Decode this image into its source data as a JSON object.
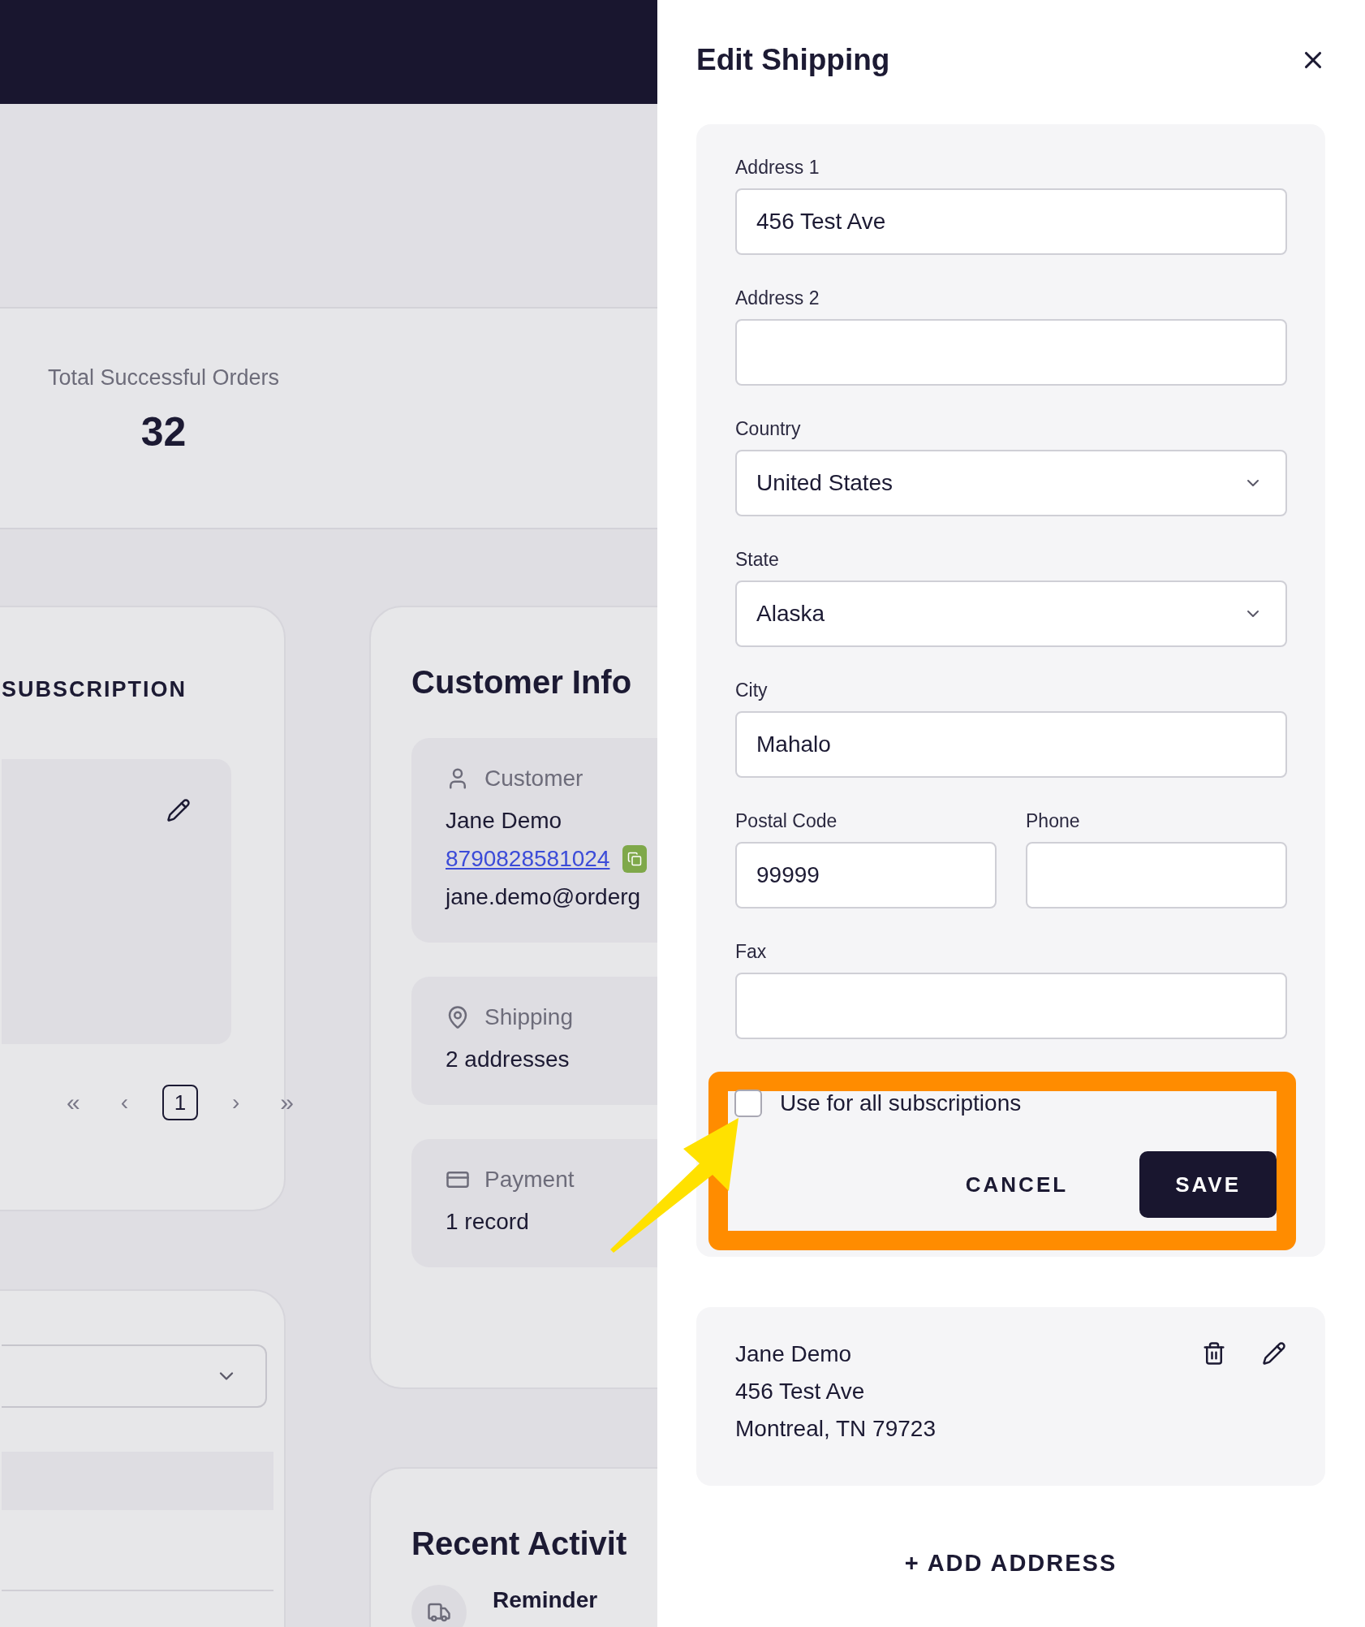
{
  "stats": {
    "label": "Total Successful Orders",
    "value": "32"
  },
  "subscription_card": {
    "title": "SUBSCRIPTION",
    "pagination": [
      {
        "label": "«",
        "kind": "first",
        "selected": false
      },
      {
        "label": "‹",
        "kind": "prev",
        "selected": false
      },
      {
        "label": "1",
        "kind": "page",
        "selected": true
      },
      {
        "label": "›",
        "kind": "next",
        "selected": false
      },
      {
        "label": "»",
        "kind": "last",
        "selected": false
      }
    ]
  },
  "customer_info": {
    "title": "Customer Info",
    "sections": [
      {
        "kind": "customer",
        "label": "Customer",
        "lines": [
          {
            "kind": "text",
            "text": "Jane Demo"
          },
          {
            "kind": "link",
            "text": "8790828581024"
          },
          {
            "kind": "text",
            "text": "jane.demo@orderg"
          }
        ]
      },
      {
        "kind": "shipping",
        "label": "Shipping",
        "lines": [
          {
            "kind": "text",
            "text": "2 addresses"
          }
        ]
      },
      {
        "kind": "payment",
        "label": "Payment",
        "lines": [
          {
            "kind": "text",
            "text": "1 record"
          }
        ]
      }
    ]
  },
  "recent_activity": {
    "title": "Recent Activit",
    "items": [
      {
        "title": "Reminder"
      }
    ]
  },
  "drawer": {
    "title": "Edit Shipping",
    "rows": [
      [
        {
          "label": "Address 1",
          "value": "456 Test Ave",
          "kind": "text"
        }
      ],
      [
        {
          "label": "Address 2",
          "kind": "text"
        }
      ],
      [
        {
          "label": "Country",
          "value": "United States",
          "kind": "select"
        }
      ],
      [
        {
          "label": "State",
          "value": "Alaska",
          "kind": "select"
        }
      ],
      [
        {
          "label": "City",
          "value": "Mahalo",
          "kind": "text"
        }
      ],
      [
        {
          "label": "Postal Code",
          "value": "99999",
          "kind": "text"
        },
        {
          "label": "Phone",
          "kind": "text"
        }
      ],
      [
        {
          "label": "Fax",
          "kind": "text"
        }
      ]
    ],
    "use_for_all": {
      "label": "Use for all subscriptions",
      "checked": false
    },
    "buttons": [
      {
        "label": "CANCEL",
        "kind": "secondary"
      },
      {
        "label": "SAVE",
        "kind": "primary"
      }
    ],
    "addresses": [
      {
        "lines": [
          "Jane Demo",
          "456 Test Ave",
          "Montreal, TN 79723"
        ]
      }
    ],
    "add_button": "+ ADD ADDRESS"
  }
}
